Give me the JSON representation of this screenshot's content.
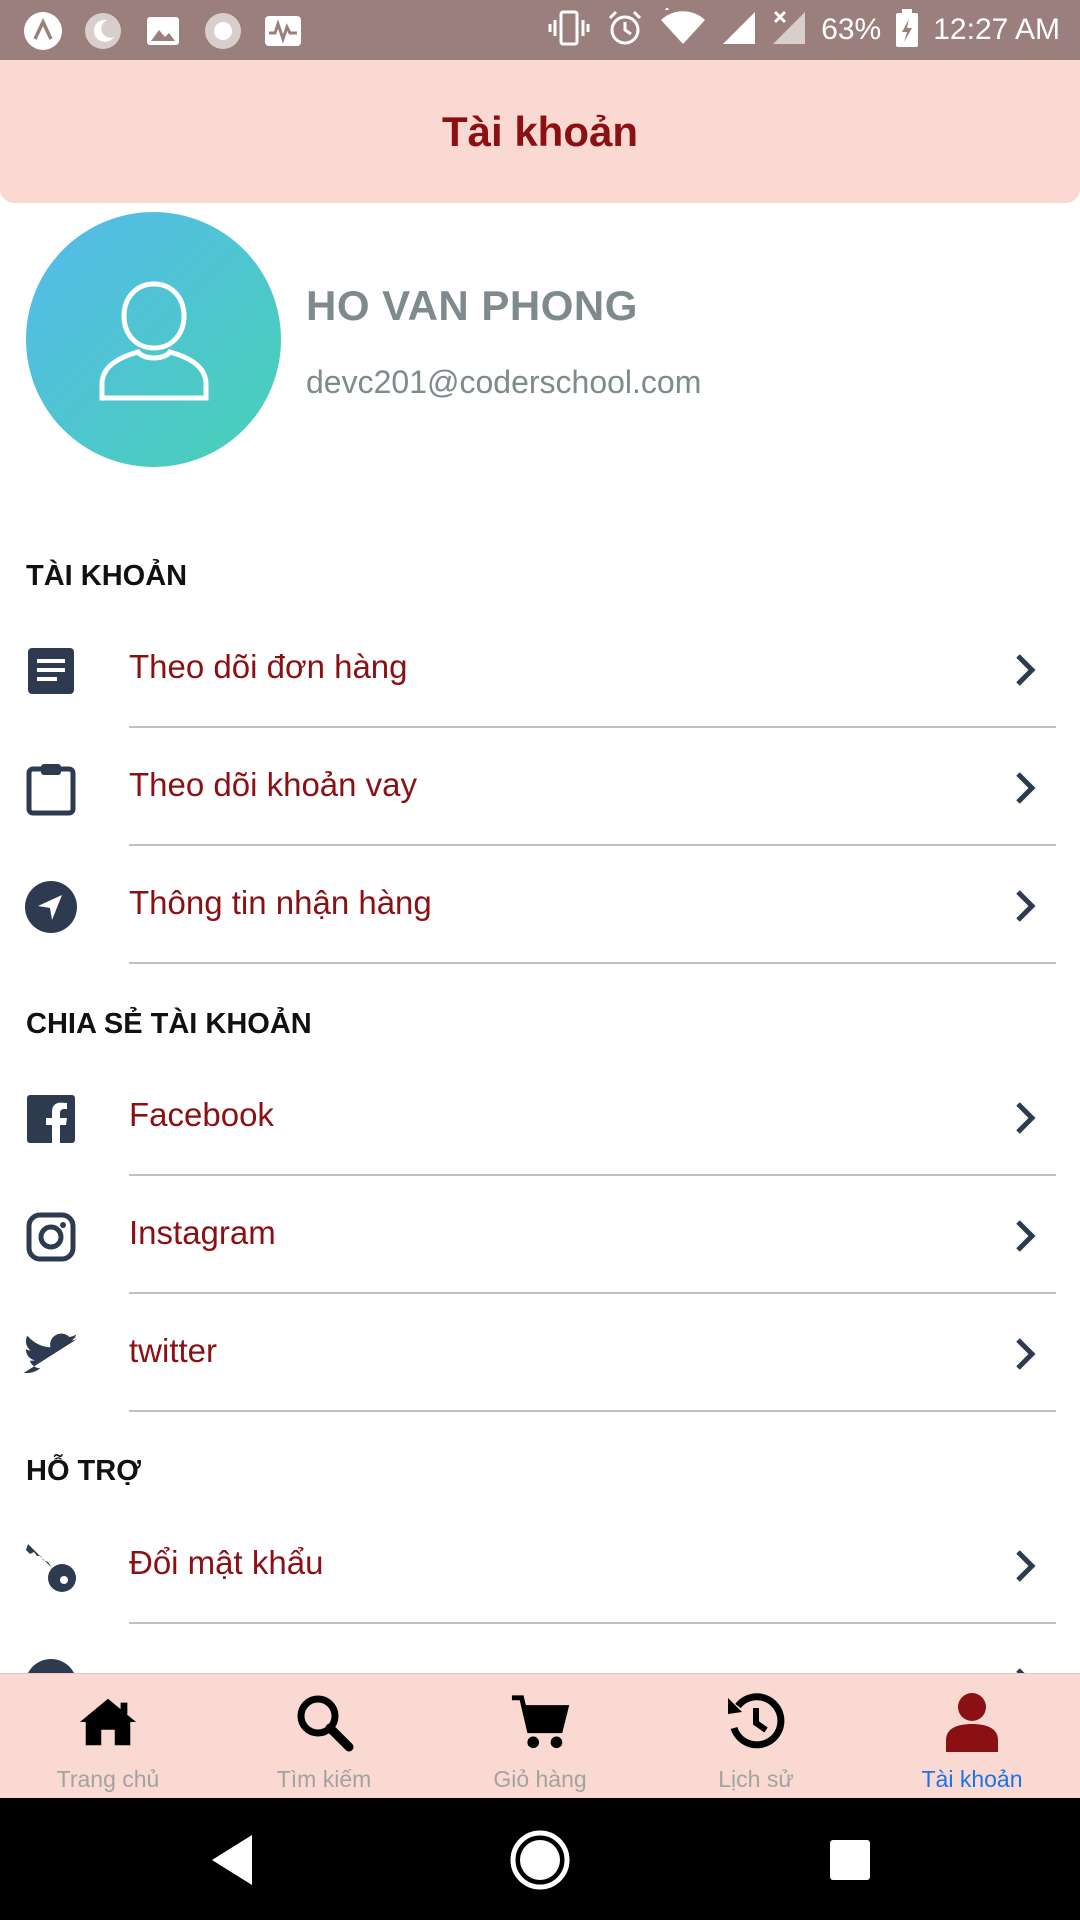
{
  "status_bar": {
    "battery": "63%",
    "time": "12:27 AM"
  },
  "header": {
    "title": "Tài khoản"
  },
  "profile": {
    "name": "HO VAN PHONG",
    "email": "devc201@coderschool.com"
  },
  "sections": {
    "account": {
      "title": "TÀI KHOẢN",
      "items": [
        {
          "label": "Theo dõi đơn hàng",
          "icon": "document-icon"
        },
        {
          "label": "Theo dõi khoản vay",
          "icon": "clipboard-icon"
        },
        {
          "label": "Thông tin nhận hàng",
          "icon": "location-arrow-icon"
        }
      ]
    },
    "share": {
      "title": "CHIA SẺ TÀI KHOẢN",
      "items": [
        {
          "label": "Facebook",
          "icon": "facebook-icon"
        },
        {
          "label": "Instagram",
          "icon": "instagram-icon"
        },
        {
          "label": "twitter",
          "icon": "twitter-icon"
        }
      ]
    },
    "support": {
      "title": "HỖ TRỢ",
      "items": [
        {
          "label": "Đổi mật khẩu",
          "icon": "key-icon"
        }
      ]
    }
  },
  "bottom_nav": {
    "items": [
      {
        "label": "Trang chủ",
        "icon": "home-icon",
        "active": false
      },
      {
        "label": "Tìm kiếm",
        "icon": "search-icon",
        "active": false
      },
      {
        "label": "Giỏ hàng",
        "icon": "cart-icon",
        "active": false
      },
      {
        "label": "Lịch sử",
        "icon": "history-icon",
        "active": false
      },
      {
        "label": "Tài khoản",
        "icon": "user-icon",
        "active": true
      }
    ]
  },
  "colors": {
    "header_bg": "#fbd9d3",
    "accent": "#8b1014",
    "icon": "#2d3a4f",
    "active_tab": "#1a73e8",
    "status_bar": "#9b7f7c"
  }
}
